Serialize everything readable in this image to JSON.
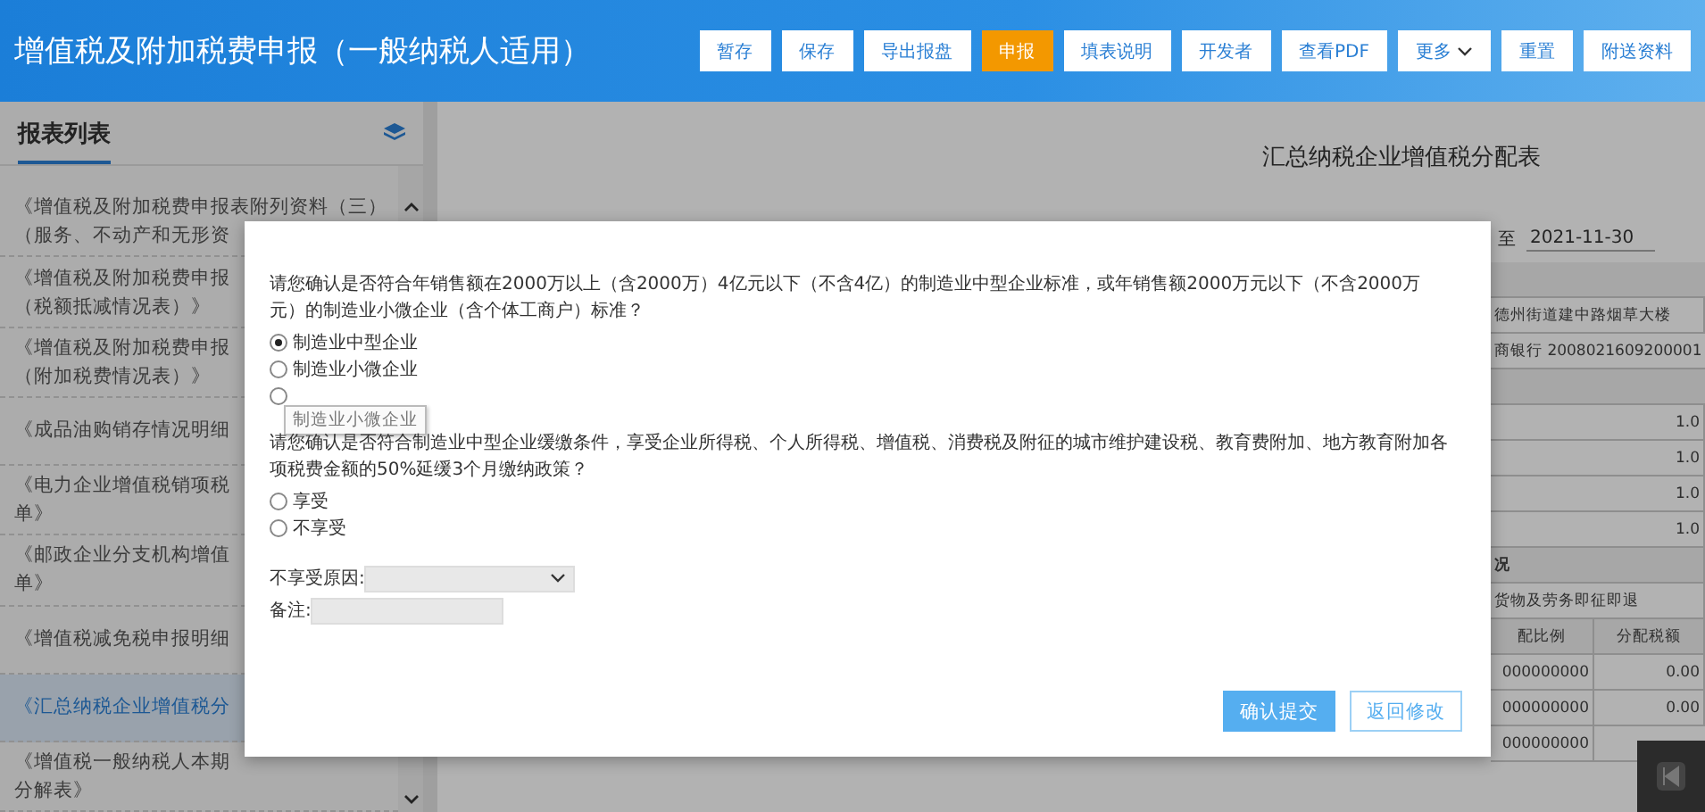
{
  "header": {
    "title": "增值税及附加税费申报（一般纳税人适用）",
    "buttons": [
      {
        "label": "暂存",
        "kind": "normal"
      },
      {
        "label": "保存",
        "kind": "normal"
      },
      {
        "label": "导出报盘",
        "kind": "normal"
      },
      {
        "label": "申报",
        "kind": "primary"
      },
      {
        "label": "填表说明",
        "kind": "normal"
      },
      {
        "label": "开发者",
        "kind": "normal"
      },
      {
        "label": "查看PDF",
        "kind": "normal"
      },
      {
        "label": "更多",
        "kind": "dropdown"
      },
      {
        "label": "重置",
        "kind": "normal"
      },
      {
        "label": "附送资料",
        "kind": "normal"
      }
    ]
  },
  "sidebar": {
    "title": "报表列表",
    "items": [
      {
        "lines": [
          "《增值税及附加税费申报表附列资料（三）",
          "（服务、不动产和无形资"
        ],
        "selected": false
      },
      {
        "lines": [
          "《增值税及附加税费申报",
          "（税额抵减情况表）》"
        ],
        "selected": false
      },
      {
        "lines": [
          "《增值税及附加税费申报",
          "（附加税费情况表）》"
        ],
        "selected": false
      },
      {
        "lines": [
          "《成品油购销存情况明细"
        ],
        "selected": false
      },
      {
        "lines": [
          "《电力企业增值税销项税",
          "单》"
        ],
        "selected": false
      },
      {
        "lines": [
          "《邮政企业分支机构增值",
          "单》"
        ],
        "selected": false
      },
      {
        "lines": [
          "《增值税减免税申报明细"
        ],
        "selected": false
      },
      {
        "lines": [
          "《汇总纳税企业增值税分"
        ],
        "selected": true
      },
      {
        "lines": [
          "《增值税一般纳税人本期",
          "分解表》"
        ],
        "selected": false
      }
    ]
  },
  "report": {
    "title": "汇总纳税企业增值税分配表",
    "period_to_label": "至",
    "period_to": "2021-11-30",
    "rows": [
      {
        "kind": "blank"
      },
      {
        "kind": "text",
        "cells": [
          "德州街道建中路烟草大楼"
        ]
      },
      {
        "kind": "text",
        "cells": [
          "商银行 2008021609200001"
        ]
      },
      {
        "kind": "blank"
      },
      {
        "kind": "value",
        "cells": [
          "1.0"
        ]
      },
      {
        "kind": "value",
        "cells": [
          "1.0"
        ]
      },
      {
        "kind": "value",
        "cells": [
          "1.0"
        ]
      },
      {
        "kind": "value",
        "cells": [
          "1.0"
        ]
      },
      {
        "kind": "section",
        "cells": [
          "况"
        ]
      },
      {
        "kind": "text",
        "cells": [
          "货物及劳务即征即退"
        ]
      },
      {
        "kind": "head",
        "cells": [
          "配比例",
          "分配税额"
        ]
      },
      {
        "kind": "pair",
        "cells": [
          "000000000",
          "0.00"
        ]
      },
      {
        "kind": "pair",
        "cells": [
          "000000000",
          "0.00"
        ]
      },
      {
        "kind": "pair",
        "cells": [
          "000000000"
        ]
      }
    ]
  },
  "dialog": {
    "questions": [
      {
        "text": "请您确认是否符合年销售额在2000万以上（含2000万）4亿元以下（不含4亿）的制造业中型企业标准，或年销售额2000万元以下（不含2000万元）的制造业小微企业（含个体工商户）标准？",
        "options": [
          {
            "label": "制造业中型企业",
            "selected": true
          },
          {
            "label": "制造业小微企业",
            "selected": false
          },
          {
            "selected": false
          }
        ]
      },
      {
        "text": "请您确认是否符合制造业中型企业缓缴条件，享受企业所得税、个人所得税、增值税、消费税及附征的城市维护建设税、教育费附加、地方教育附加各项税费金额的50%延缓3个月缴纳政策？",
        "options": [
          {
            "label": "享受",
            "selected": false
          },
          {
            "label": "不享受",
            "selected": false
          }
        ]
      }
    ],
    "tooltip": "制造业小微企业",
    "fields": [
      {
        "kind": "select",
        "label": "不享受原因:"
      },
      {
        "kind": "input",
        "label": "备注:"
      }
    ],
    "buttons": [
      {
        "label": "确认提交",
        "kind": "primary"
      },
      {
        "label": "返回修改",
        "kind": "outline"
      }
    ]
  }
}
